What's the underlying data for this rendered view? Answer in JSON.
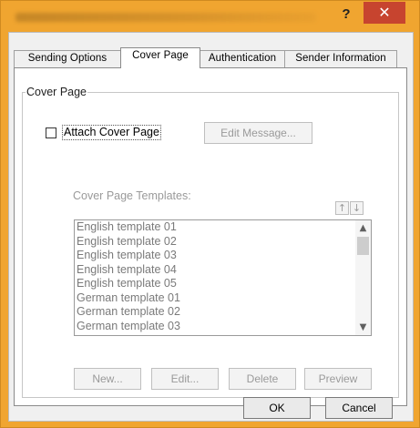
{
  "window": {
    "help_label": "?",
    "close_label": "✕",
    "accent": "#f0a530",
    "close_color": "#c7442f"
  },
  "tabs": [
    {
      "label": "Sending Options"
    },
    {
      "label": "Cover Page"
    },
    {
      "label": "Authentication"
    },
    {
      "label": "Sender Information"
    }
  ],
  "active_tab": "Cover Page",
  "group": {
    "title": "Cover Page",
    "attach_label": "Attach Cover Page",
    "attach_checked": false,
    "edit_message_label": "Edit Message...",
    "templates_label": "Cover Page Templates:",
    "move_up_icon": "↑",
    "move_down_icon": "↓",
    "templates": [
      "English template 01",
      "English template 02",
      "English template 03",
      "English template 04",
      "English template 05",
      "German template 01",
      "German template 02",
      "German template 03"
    ],
    "scroll_up_icon": "▲",
    "scroll_down_icon": "▼",
    "buttons": {
      "new": "New...",
      "edit": "Edit...",
      "delete": "Delete",
      "preview": "Preview"
    }
  },
  "footer": {
    "ok": "OK",
    "cancel": "Cancel"
  }
}
